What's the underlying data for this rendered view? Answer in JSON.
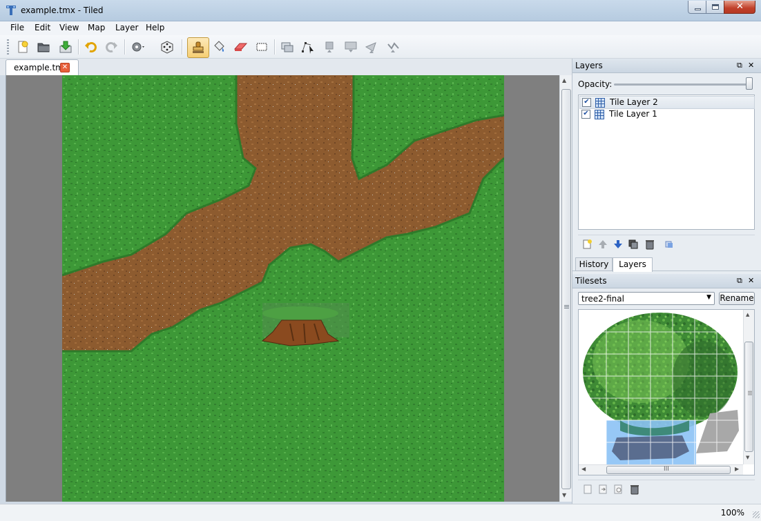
{
  "window": {
    "title": "example.tmx - Tiled"
  },
  "menu": {
    "items": [
      "File",
      "Edit",
      "View",
      "Map",
      "Layer",
      "Help"
    ]
  },
  "toolbar": {
    "icons": [
      "new-file-icon",
      "open-folder-icon",
      "save-icon",
      "undo-icon",
      "redo-icon",
      "random-settings-icon",
      "dice-icon",
      "stamp-brush-icon",
      "bucket-fill-icon",
      "eraser-icon",
      "rectangle-select-icon",
      "select-objects-icon",
      "edit-polygon-icon",
      "insert-rectangle-icon",
      "insert-image-icon",
      "insert-polygon-icon",
      "insert-polyline-icon"
    ],
    "active_tool": "stamp-brush-icon"
  },
  "document_tabs": [
    {
      "label": "example.tmx",
      "active": true
    }
  ],
  "layers_panel": {
    "title": "Layers",
    "opacity_label": "Opacity:",
    "opacity": 1.0,
    "layers": [
      {
        "name": "Tile Layer 2",
        "visible": true,
        "selected": true
      },
      {
        "name": "Tile Layer 1",
        "visible": true,
        "selected": false
      }
    ]
  },
  "bottom_tabs": {
    "history": "History",
    "layers": "Layers",
    "active": "Layers"
  },
  "tilesets_panel": {
    "title": "Tilesets",
    "selected_tileset": "tree2-final",
    "rename_label": "Rename",
    "scroll_h_label": "III",
    "scroll_v_label": "III"
  },
  "statusbar": {
    "zoom": "100%"
  },
  "colors": {
    "grass": "#3f9a3a",
    "dirt": "#8c5a2e",
    "map_background": "#7f7f7f",
    "selection_blue": "#8cc2f5"
  }
}
